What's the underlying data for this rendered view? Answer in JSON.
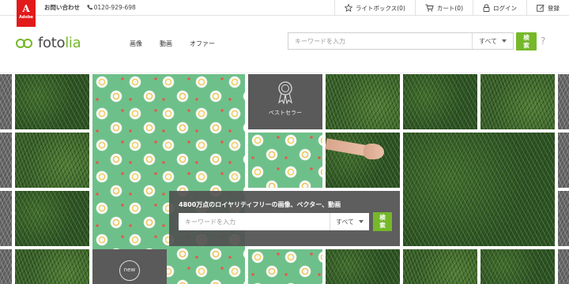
{
  "brand": {
    "adobe_mark": "A",
    "adobe_word": "Adobe",
    "logo_prefix": "foto",
    "logo_suffix": "lia",
    "accent_color": "#76b82a",
    "adobe_color": "#e21a1a"
  },
  "topbar": {
    "contact_label": "お問い合わせ",
    "phone_icon": "phone-icon",
    "phone": "0120-929-698",
    "links": [
      {
        "icon": "star-icon",
        "label": "ライトボックス(0)"
      },
      {
        "icon": "cart-icon",
        "label": "カート(0)"
      },
      {
        "icon": "lock-icon",
        "label": "ログイン"
      },
      {
        "icon": "edit-icon",
        "label": "登録"
      }
    ]
  },
  "nav": {
    "items": [
      "画像",
      "動画",
      "オファー"
    ]
  },
  "header_search": {
    "placeholder": "キーワードを入力",
    "select_value": "すべて",
    "button_line1": "検",
    "button_line2": "索",
    "help": "?"
  },
  "hero": {
    "bestseller_label": "ベストセラー",
    "new_label": "new",
    "headline": "4800万点のロイヤリティフリーの画像、ベクター、動画",
    "search_placeholder": "キーワードを入力",
    "select_value": "すべて",
    "button_line1": "検",
    "button_line2": "索"
  }
}
